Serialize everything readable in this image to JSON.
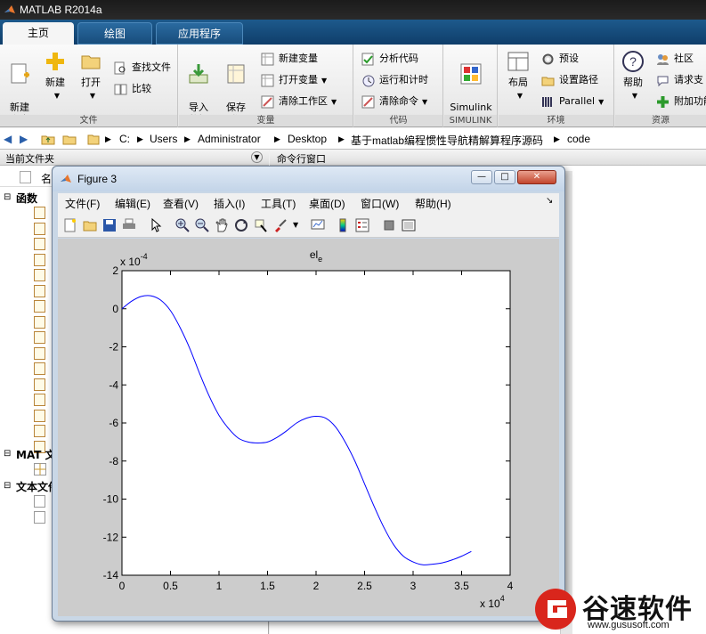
{
  "app": {
    "title": "MATLAB R2014a"
  },
  "tabs": [
    {
      "label": "主页"
    },
    {
      "label": "绘图"
    },
    {
      "label": "应用程序"
    }
  ],
  "ribbon": {
    "new_script": "新建\n脚本",
    "new": "新建",
    "open": "打开",
    "find_files": "查找文件",
    "compare": "比较",
    "import": "导入\n数据",
    "save_ws": "保存\n工作区",
    "new_var": "新建变量",
    "open_var": "打开变量",
    "clear_ws": "清除工作区",
    "analyze": "分析代码",
    "run_time": "运行和计时",
    "clear_cmd": "清除命令",
    "simulink": "Simulink\n库",
    "layout": "布局",
    "prefs": "预设",
    "set_path": "设置路径",
    "parallel": "Parallel",
    "help": "帮助",
    "community": "社区",
    "request": "请求支",
    "addons": "附加功能",
    "groups": {
      "file": "文件",
      "variable": "变量",
      "code": "代码",
      "simulink": "SIMULINK",
      "env": "环境",
      "resources": "资源"
    }
  },
  "address": {
    "parts": [
      "C:",
      "Users",
      "Administrator",
      "Desktop",
      "基于matlab编程惯性导航精解算程序源码",
      "code"
    ]
  },
  "left_pane": {
    "title": "当前文件夹",
    "col": "名",
    "functions": "函数",
    "mat": "MAT 文",
    "text_files": "文本文件"
  },
  "right_pane": {
    "title": "命令行窗口"
  },
  "figure": {
    "title": "Figure 3",
    "menu": [
      "文件(F)",
      "编辑(E)",
      "查看(V)",
      "插入(I)",
      "工具(T)",
      "桌面(D)",
      "窗口(W)",
      "帮助(H)"
    ]
  },
  "chart_data": {
    "type": "line",
    "title_main": "el",
    "title_sub": "e",
    "x_multiplier": "x 10",
    "x_exp": "4",
    "y_multiplier": "x 10",
    "y_exp": "-4",
    "xlim": [
      0,
      4
    ],
    "ylim": [
      -14,
      2
    ],
    "xticks": [
      "0",
      "0.5",
      "1",
      "1.5",
      "2",
      "2.5",
      "3",
      "3.5",
      "4"
    ],
    "yticks": [
      "2",
      "0",
      "-2",
      "-4",
      "-6",
      "-8",
      "-10",
      "-12",
      "-14"
    ],
    "line_color": "#0000ff",
    "series": [
      {
        "x": [
          0,
          0.1,
          0.2,
          0.3,
          0.4,
          0.5,
          0.6,
          0.7,
          0.8,
          0.9,
          1.0,
          1.1,
          1.2,
          1.3,
          1.4,
          1.5,
          1.6,
          1.7,
          1.8,
          1.9,
          2.0,
          2.1,
          2.2,
          2.3,
          2.4,
          2.5,
          2.6,
          2.7,
          2.8,
          2.9,
          3.0,
          3.1,
          3.2,
          3.3,
          3.4,
          3.5,
          3.6
        ],
        "y": [
          0.0,
          0.4,
          0.65,
          0.68,
          0.45,
          -0.1,
          -1.0,
          -2.1,
          -3.4,
          -4.6,
          -5.6,
          -6.3,
          -6.8,
          -7.0,
          -7.05,
          -7.0,
          -6.75,
          -6.4,
          -6.0,
          -5.75,
          -5.65,
          -5.75,
          -6.2,
          -7.0,
          -8.0,
          -9.2,
          -10.4,
          -11.5,
          -12.4,
          -13.0,
          -13.3,
          -13.45,
          -13.42,
          -13.35,
          -13.2,
          -13.0,
          -12.75
        ]
      }
    ]
  },
  "watermark": {
    "text": "谷速软件",
    "url": "www.gususoft.com"
  }
}
